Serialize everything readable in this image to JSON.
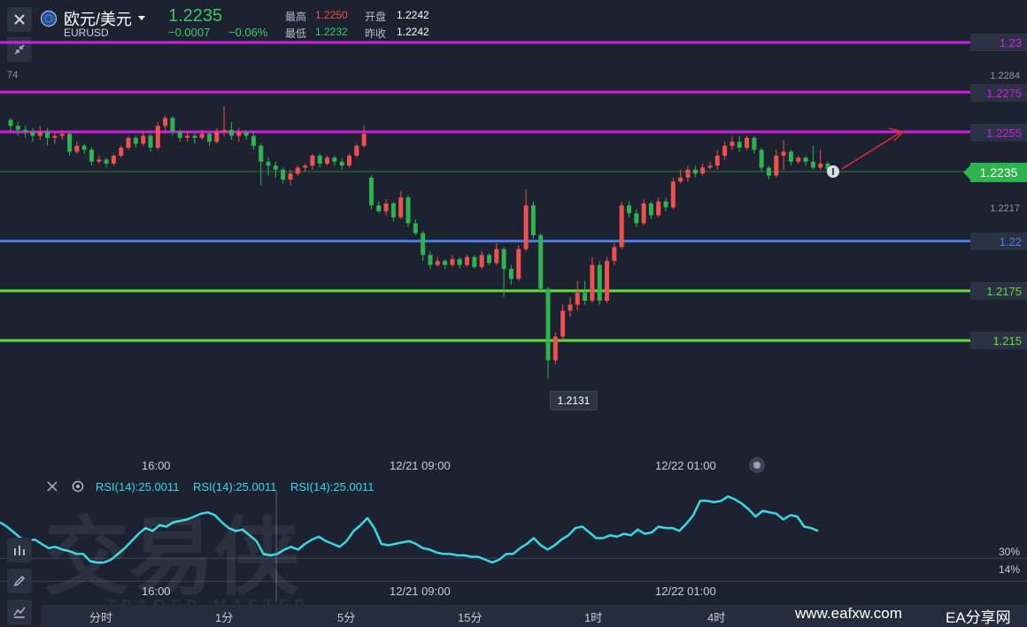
{
  "header": {
    "title": "欧元/美元",
    "symbol": "EURUSD",
    "price": "1.2235",
    "change": "−0.0007",
    "change_pct": "−0.06%",
    "high_label": "最高",
    "high": "1.2250",
    "low_label": "最低",
    "low": "1.2232",
    "open_label": "开盘",
    "open": "1.2242",
    "prev_close_label": "昨收",
    "prev_close": "1.2242"
  },
  "colors": {
    "up": "#ef4f4f",
    "down": "#2fb34f",
    "magenta": "#d21ce0",
    "blue": "#4a7de8",
    "green_line": "#5fdc3b",
    "rsi": "#39d8e6",
    "current_price": "#2fb34f"
  },
  "icons": {
    "close": "close-icon",
    "collapse": "collapse-arrows-icon",
    "settings": "gear-icon",
    "indicator": "indicator-icon",
    "draw": "pen-icon",
    "line_chart": "line-chart-icon",
    "dropdown": "chevron-down-icon",
    "info": "info-icon"
  },
  "chart_data": {
    "type": "candlestick",
    "y_ticks": [
      "74",
      "1.2284",
      "1.2217"
    ],
    "levels": [
      {
        "label": "1.23",
        "value": 1.23,
        "color": "#d21ce0"
      },
      {
        "label": "1.2275",
        "value": 1.2275,
        "color": "#d21ce0"
      },
      {
        "label": "1.2255",
        "value": 1.2255,
        "color": "#d21ce0"
      },
      {
        "label": "1.22",
        "value": 1.22,
        "color": "#4a7de8"
      },
      {
        "label": "1.2175",
        "value": 1.2175,
        "color": "#5fdc3b"
      },
      {
        "label": "1.215",
        "value": 1.215,
        "color": "#5fdc3b"
      }
    ],
    "current_price": {
      "label": "1.2235",
      "value": 1.2235
    },
    "min_marker": {
      "label": "1.2131",
      "value": 1.2131
    },
    "ylim": [
      1.2105,
      1.232
    ],
    "x_labels": [
      "16:00",
      "12/21 09:00",
      "12/22 01:00"
    ],
    "candles": [
      [
        1.2261,
        1.2258,
        1.2262,
        1.2255
      ],
      [
        1.2258,
        1.2256,
        1.226,
        1.2253
      ],
      [
        1.2256,
        1.2255,
        1.2258,
        1.2252
      ],
      [
        1.2255,
        1.2253,
        1.2257,
        1.225
      ],
      [
        1.2253,
        1.2255,
        1.2258,
        1.2251
      ],
      [
        1.2255,
        1.2252,
        1.2257,
        1.2248
      ],
      [
        1.2252,
        1.2253,
        1.2255,
        1.2249
      ],
      [
        1.2253,
        1.2254,
        1.2256,
        1.2251
      ],
      [
        1.2254,
        1.2245,
        1.2255,
        1.2243
      ],
      [
        1.2245,
        1.2248,
        1.225,
        1.2244
      ],
      [
        1.2248,
        1.2246,
        1.2249,
        1.2244
      ],
      [
        1.2246,
        1.224,
        1.2247,
        1.2238
      ],
      [
        1.224,
        1.2241,
        1.2243,
        1.2239
      ],
      [
        1.2241,
        1.2239,
        1.2242,
        1.2237
      ],
      [
        1.2239,
        1.2243,
        1.2244,
        1.2238
      ],
      [
        1.2243,
        1.2247,
        1.2248,
        1.2242
      ],
      [
        1.2247,
        1.2252,
        1.2253,
        1.2246
      ],
      [
        1.2252,
        1.2249,
        1.2253,
        1.2247
      ],
      [
        1.2249,
        1.2253,
        1.2255,
        1.2248
      ],
      [
        1.2253,
        1.2247,
        1.2254,
        1.2245
      ],
      [
        1.2247,
        1.2258,
        1.226,
        1.2246
      ],
      [
        1.2258,
        1.2262,
        1.2263,
        1.2255
      ],
      [
        1.2262,
        1.2255,
        1.2263,
        1.2253
      ],
      [
        1.2255,
        1.2252,
        1.2256,
        1.225
      ],
      [
        1.2252,
        1.2253,
        1.2255,
        1.225
      ],
      [
        1.2253,
        1.2252,
        1.2255,
        1.2249
      ],
      [
        1.2252,
        1.2254,
        1.2256,
        1.2251
      ],
      [
        1.2254,
        1.225,
        1.2255,
        1.2248
      ],
      [
        1.225,
        1.2255,
        1.2257,
        1.2249
      ],
      [
        1.2255,
        1.2256,
        1.2268,
        1.2253
      ],
      [
        1.2256,
        1.2253,
        1.226,
        1.2251
      ],
      [
        1.2253,
        1.2255,
        1.2257,
        1.225
      ],
      [
        1.2255,
        1.2253,
        1.2256,
        1.2251
      ],
      [
        1.2253,
        1.2248,
        1.2255,
        1.2246
      ],
      [
        1.2248,
        1.224,
        1.2249,
        1.2228
      ],
      [
        1.224,
        1.2238,
        1.2242,
        1.2233
      ],
      [
        1.2238,
        1.2236,
        1.224,
        1.2232
      ],
      [
        1.2236,
        1.2231,
        1.2237,
        1.2229
      ],
      [
        1.2231,
        1.2234,
        1.2236,
        1.2228
      ],
      [
        1.2234,
        1.2237,
        1.2238,
        1.2233
      ],
      [
        1.2237,
        1.2238,
        1.2239,
        1.2235
      ],
      [
        1.2238,
        1.2243,
        1.2244,
        1.2236
      ],
      [
        1.2243,
        1.2239,
        1.2244,
        1.2237
      ],
      [
        1.2239,
        1.2242,
        1.2243,
        1.2238
      ],
      [
        1.2242,
        1.224,
        1.2243,
        1.2238
      ],
      [
        1.224,
        1.2238,
        1.2242,
        1.2236
      ],
      [
        1.2238,
        1.2243,
        1.2244,
        1.2237
      ],
      [
        1.2243,
        1.2248,
        1.2249,
        1.2242
      ],
      [
        1.2248,
        1.2254,
        1.2258,
        1.2247
      ],
      [
        1.2232,
        1.2218,
        1.2233,
        1.2216
      ],
      [
        1.2218,
        1.2215,
        1.222,
        1.2214
      ],
      [
        1.2215,
        1.2219,
        1.2221,
        1.2213
      ],
      [
        1.2219,
        1.2212,
        1.222,
        1.221
      ],
      [
        1.2212,
        1.2222,
        1.2225,
        1.2211
      ],
      [
        1.2222,
        1.2209,
        1.2223,
        1.2207
      ],
      [
        1.2209,
        1.2204,
        1.2211,
        1.2203
      ],
      [
        1.2204,
        1.2193,
        1.2205,
        1.219
      ],
      [
        1.2193,
        1.2188,
        1.2195,
        1.2186
      ],
      [
        1.2188,
        1.219,
        1.2192,
        1.2187
      ],
      [
        1.219,
        1.2188,
        1.2191,
        1.2186
      ],
      [
        1.2188,
        1.2191,
        1.2193,
        1.2187
      ],
      [
        1.2191,
        1.2188,
        1.2192,
        1.2186
      ],
      [
        1.2188,
        1.2192,
        1.2193,
        1.2187
      ],
      [
        1.2192,
        1.2187,
        1.2193,
        1.2186
      ],
      [
        1.2187,
        1.2193,
        1.2195,
        1.2186
      ],
      [
        1.2193,
        1.2189,
        1.2194,
        1.2188
      ],
      [
        1.2189,
        1.2196,
        1.2199,
        1.2188
      ],
      [
        1.2196,
        1.2186,
        1.2197,
        1.2172
      ],
      [
        1.2186,
        1.2181,
        1.2188,
        1.2178
      ],
      [
        1.2181,
        1.2196,
        1.2198,
        1.218
      ],
      [
        1.2196,
        1.2218,
        1.2226,
        1.2195
      ],
      [
        1.2218,
        1.2203,
        1.222,
        1.2201
      ],
      [
        1.2203,
        1.2176,
        1.2204,
        1.2174
      ],
      [
        1.2176,
        1.214,
        1.2177,
        1.2131
      ],
      [
        1.214,
        1.2152,
        1.2154,
        1.2138
      ],
      [
        1.2152,
        1.2165,
        1.2168,
        1.215
      ],
      [
        1.2165,
        1.2168,
        1.2172,
        1.2162
      ],
      [
        1.2168,
        1.2174,
        1.218,
        1.2165
      ],
      [
        1.2174,
        1.217,
        1.218,
        1.2168
      ],
      [
        1.217,
        1.2188,
        1.2192,
        1.2169
      ],
      [
        1.2188,
        1.217,
        1.219,
        1.2168
      ],
      [
        1.217,
        1.219,
        1.2192,
        1.2169
      ],
      [
        1.219,
        1.2197,
        1.2199,
        1.2188
      ],
      [
        1.2197,
        1.2218,
        1.222,
        1.2196
      ],
      [
        1.2218,
        1.2214,
        1.222,
        1.2212
      ],
      [
        1.2214,
        1.2209,
        1.2216,
        1.2207
      ],
      [
        1.2209,
        1.2219,
        1.2221,
        1.2208
      ],
      [
        1.2219,
        1.2213,
        1.222,
        1.2211
      ],
      [
        1.2213,
        1.222,
        1.2222,
        1.2212
      ],
      [
        1.222,
        1.2217,
        1.2222,
        1.2215
      ],
      [
        1.2217,
        1.223,
        1.2232,
        1.2216
      ],
      [
        1.223,
        1.2232,
        1.2236,
        1.2229
      ],
      [
        1.2232,
        1.2236,
        1.2238,
        1.223
      ],
      [
        1.2236,
        1.2234,
        1.2238,
        1.2232
      ],
      [
        1.2234,
        1.2237,
        1.2239,
        1.2233
      ],
      [
        1.2237,
        1.2238,
        1.224,
        1.2236
      ],
      [
        1.2238,
        1.2243,
        1.2246,
        1.2236
      ],
      [
        1.2243,
        1.2248,
        1.225,
        1.2241
      ],
      [
        1.2248,
        1.225,
        1.2253,
        1.2246
      ],
      [
        1.225,
        1.2247,
        1.2253,
        1.2245
      ],
      [
        1.2247,
        1.2252,
        1.2253,
        1.2246
      ],
      [
        1.2252,
        1.2246,
        1.2253,
        1.2244
      ],
      [
        1.2246,
        1.2237,
        1.2247,
        1.2235
      ],
      [
        1.2237,
        1.2233,
        1.2238,
        1.2231
      ],
      [
        1.2233,
        1.2243,
        1.2246,
        1.2232
      ],
      [
        1.2243,
        1.2245,
        1.2251,
        1.2236
      ],
      [
        1.2245,
        1.224,
        1.2246,
        1.2238
      ],
      [
        1.224,
        1.2242,
        1.2243,
        1.2239
      ],
      [
        1.2242,
        1.224,
        1.2243,
        1.2238
      ],
      [
        1.224,
        1.2237,
        1.2248,
        1.2236
      ],
      [
        1.2237,
        1.2239,
        1.2246,
        1.2236
      ],
      [
        1.2239,
        1.2236,
        1.224,
        1.2235
      ]
    ]
  },
  "rsi": {
    "labels": [
      "RSI(14):25.0011",
      "RSI(14):25.0011",
      "RSI(14):25.0011"
    ],
    "levels": [
      {
        "label": "30%",
        "value": 30
      },
      {
        "label": "14%",
        "value": 14
      }
    ],
    "ylim": [
      0,
      80
    ],
    "values": [
      55,
      52,
      48,
      44,
      42,
      43,
      40,
      37,
      38,
      36,
      35,
      33,
      33,
      28,
      27,
      27,
      29,
      33,
      37,
      42,
      47,
      51,
      49,
      53,
      52,
      55,
      56,
      57,
      59,
      61,
      62,
      60,
      55,
      51,
      49,
      50,
      46,
      42,
      33,
      32,
      33,
      36,
      38,
      36,
      40,
      43,
      45,
      42,
      40,
      38,
      42,
      49,
      53,
      58,
      51,
      40,
      39,
      40,
      41,
      42,
      40,
      37,
      36,
      34,
      33,
      33,
      32,
      32,
      31,
      31,
      29,
      27,
      29,
      33,
      33,
      37,
      40,
      44,
      39,
      36,
      39,
      43,
      46,
      51,
      52,
      48,
      44,
      44,
      46,
      45,
      47,
      46,
      50,
      47,
      48,
      52,
      51,
      51,
      49,
      54,
      60,
      70,
      70,
      69,
      70,
      73,
      71,
      68,
      64,
      59,
      63,
      62,
      61,
      57,
      60,
      59,
      52,
      51,
      49
    ],
    "x_labels": [
      "16:00",
      "12/21 09:00",
      "12/22 01:00"
    ]
  },
  "bottom_bar": {
    "items": [
      "分时",
      "1分",
      "5分",
      "15分",
      "1时",
      "4时"
    ]
  },
  "watermark": {
    "brand": "交易侠",
    "brand_en": "TRADER MASTER",
    "site": "www.eafxw.com",
    "site_name": "EA分享网"
  }
}
